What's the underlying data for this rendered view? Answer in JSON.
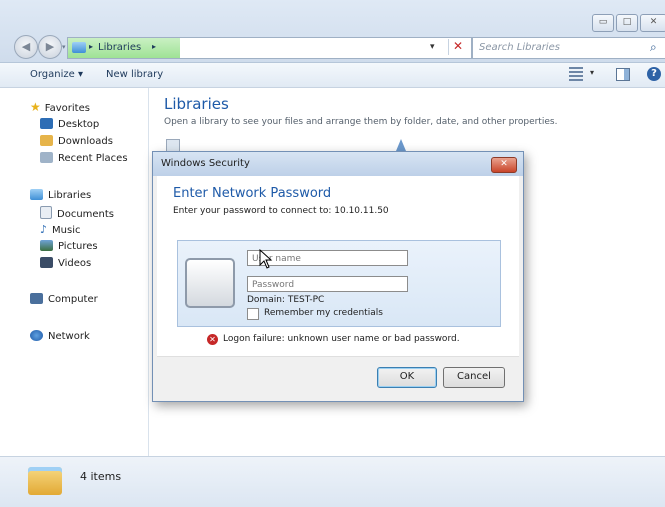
{
  "window": {
    "breadcrumb": "Libraries",
    "search_placeholder": "Search Libraries",
    "min_glyph": "▭",
    "max_glyph": "□",
    "close_glyph": "✕"
  },
  "toolbar": {
    "organize": "Organize ▾",
    "new_library": "New library"
  },
  "sidebar": {
    "favorites": "Favorites",
    "desktop": "Desktop",
    "downloads": "Downloads",
    "recent_places": "Recent Places",
    "libraries": "Libraries",
    "documents": "Documents",
    "music": "Music",
    "pictures": "Pictures",
    "videos": "Videos",
    "computer": "Computer",
    "network": "Network"
  },
  "content": {
    "title": "Libraries",
    "description": "Open a library to see your files and arrange them by folder, date, and other properties."
  },
  "status": {
    "items": "4 items"
  },
  "dialog": {
    "title": "Windows Security",
    "heading": "Enter Network Password",
    "subtitle": "Enter your password to connect to: 10.10.11.50",
    "username_placeholder": "User name",
    "password_placeholder": "Password",
    "domain": "Domain: TEST-PC",
    "remember_label": "Remember my credentials",
    "error": "Logon failure: unknown user name or bad password.",
    "ok": "OK",
    "cancel": "Cancel"
  },
  "colors": {
    "accent": "#1e5aa8",
    "error": "#c62828",
    "address_highlight": "#a9e6a0"
  }
}
